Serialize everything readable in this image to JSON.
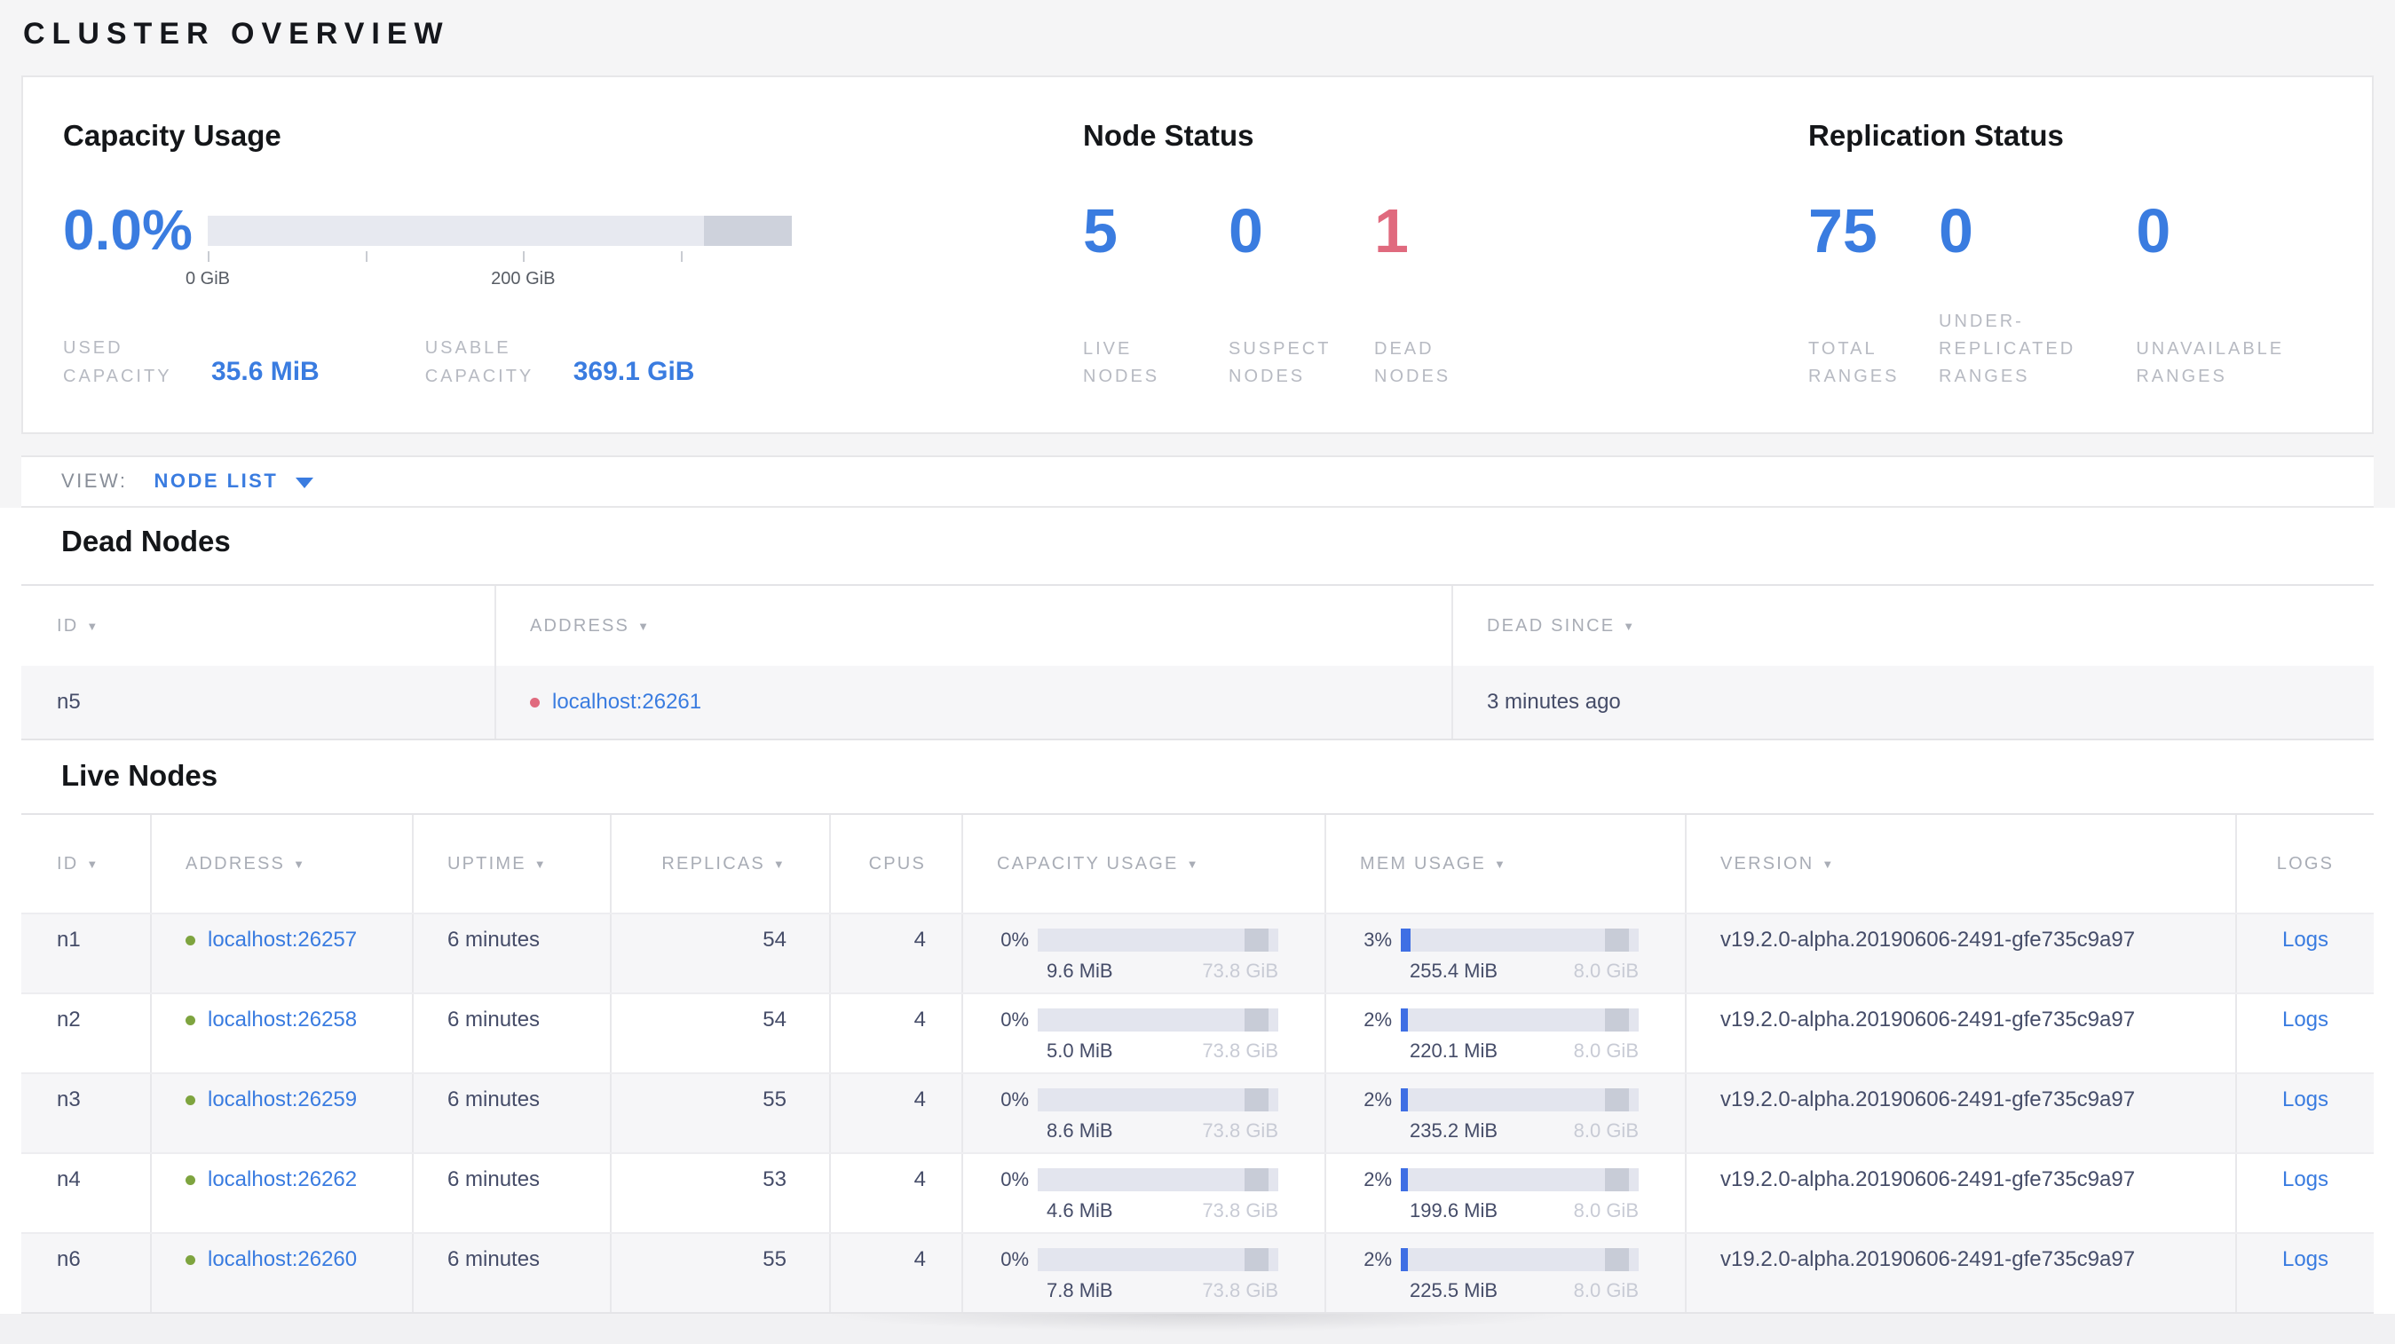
{
  "page": {
    "title": "CLUSTER OVERVIEW"
  },
  "accents": {
    "blue": "#3a7ce0",
    "red": "#e06a7e",
    "green_live_dot": "#7ea43f",
    "bar_track": "#e3e5ee",
    "bar_reserved": "#c8ccd7",
    "bar_fill_blue": "#3f6fe4"
  },
  "summary": {
    "capacity": {
      "heading": "Capacity Usage",
      "percent": "0.0%",
      "axis_start_label": "0 GiB",
      "axis_mid_label": "200 GiB",
      "used_label": "USED CAPACITY",
      "used_value": "35.6 MiB",
      "usable_label": "USABLE CAPACITY",
      "usable_value": "369.1 GiB"
    },
    "node_status": {
      "heading": "Node Status",
      "metrics": [
        {
          "value": "5",
          "label": "LIVE NODES",
          "color": "blue"
        },
        {
          "value": "0",
          "label": "SUSPECT NODES",
          "color": "blue"
        },
        {
          "value": "1",
          "label": "DEAD NODES",
          "color": "red"
        }
      ]
    },
    "replication": {
      "heading": "Replication Status",
      "metrics": [
        {
          "value": "75",
          "label": "TOTAL RANGES",
          "color": "blue"
        },
        {
          "value": "0",
          "label": "UNDER-REPLICATED RANGES",
          "color": "blue"
        },
        {
          "value": "0",
          "label": "UNAVAILABLE RANGES",
          "color": "blue"
        }
      ]
    }
  },
  "view_bar": {
    "label": "VIEW:",
    "selected": "NODE LIST"
  },
  "dead_nodes": {
    "heading": "Dead Nodes",
    "columns": [
      {
        "label": "ID",
        "sortable": true
      },
      {
        "label": "ADDRESS",
        "sortable": true
      },
      {
        "label": "DEAD SINCE",
        "sortable": true
      }
    ],
    "rows": [
      {
        "id": "n5",
        "address": "localhost:26261",
        "status": "dead",
        "dead_since": "3 minutes ago"
      }
    ]
  },
  "live_nodes": {
    "heading": "Live Nodes",
    "columns": [
      {
        "label": "ID",
        "sortable": true
      },
      {
        "label": "ADDRESS",
        "sortable": true
      },
      {
        "label": "UPTIME",
        "sortable": true
      },
      {
        "label": "REPLICAS",
        "sortable": true
      },
      {
        "label": "CPUS",
        "sortable": false
      },
      {
        "label": "CAPACITY USAGE",
        "sortable": true
      },
      {
        "label": "MEM USAGE",
        "sortable": true
      },
      {
        "label": "VERSION",
        "sortable": true
      },
      {
        "label": "LOGS",
        "sortable": false
      }
    ],
    "rows": [
      {
        "id": "n1",
        "address": "localhost:26257",
        "status": "live",
        "uptime": "6 minutes",
        "replicas": "54",
        "cpus": "4",
        "cap_pct": "0%",
        "cap_used": "9.6 MiB",
        "cap_total": "73.8 GiB",
        "mem_pct": "3%",
        "mem_used": "255.4 MiB",
        "mem_total": "8.0 GiB",
        "version": "v19.2.0-alpha.20190606-2491-gfe735c9a97",
        "logs": "Logs"
      },
      {
        "id": "n2",
        "address": "localhost:26258",
        "status": "live",
        "uptime": "6 minutes",
        "replicas": "54",
        "cpus": "4",
        "cap_pct": "0%",
        "cap_used": "5.0 MiB",
        "cap_total": "73.8 GiB",
        "mem_pct": "2%",
        "mem_used": "220.1 MiB",
        "mem_total": "8.0 GiB",
        "version": "v19.2.0-alpha.20190606-2491-gfe735c9a97",
        "logs": "Logs"
      },
      {
        "id": "n3",
        "address": "localhost:26259",
        "status": "live",
        "uptime": "6 minutes",
        "replicas": "55",
        "cpus": "4",
        "cap_pct": "0%",
        "cap_used": "8.6 MiB",
        "cap_total": "73.8 GiB",
        "mem_pct": "2%",
        "mem_used": "235.2 MiB",
        "mem_total": "8.0 GiB",
        "version": "v19.2.0-alpha.20190606-2491-gfe735c9a97",
        "logs": "Logs"
      },
      {
        "id": "n4",
        "address": "localhost:26262",
        "status": "live",
        "uptime": "6 minutes",
        "replicas": "53",
        "cpus": "4",
        "cap_pct": "0%",
        "cap_used": "4.6 MiB",
        "cap_total": "73.8 GiB",
        "mem_pct": "2%",
        "mem_used": "199.6 MiB",
        "mem_total": "8.0 GiB",
        "version": "v19.2.0-alpha.20190606-2491-gfe735c9a97",
        "logs": "Logs"
      },
      {
        "id": "n6",
        "address": "localhost:26260",
        "status": "live",
        "uptime": "6 minutes",
        "replicas": "55",
        "cpus": "4",
        "cap_pct": "0%",
        "cap_used": "7.8 MiB",
        "cap_total": "73.8 GiB",
        "mem_pct": "2%",
        "mem_used": "225.5 MiB",
        "mem_total": "8.0 GiB",
        "version": "v19.2.0-alpha.20190606-2491-gfe735c9a97",
        "logs": "Logs"
      }
    ]
  }
}
